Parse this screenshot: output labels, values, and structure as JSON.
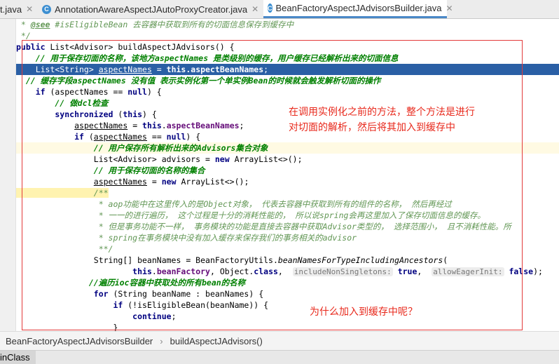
{
  "tabs": [
    {
      "label": "t.java",
      "active": false
    },
    {
      "label": "AnnotationAwareAspectJAutoProxyCreator.java",
      "active": false
    },
    {
      "label": "BeanFactoryAspectJAdvisorsBuilder.java",
      "active": true
    }
  ],
  "code": {
    "l0_a": " * ",
    "l0_see": "@see",
    "l0_b": " #isEligibleBean 去容器中获取到所有的切面信息保存到缓存中",
    "l1": " */",
    "l2_kw": "public",
    "l2_rest": " List<Advisor> buildAspectJAdvisors() {",
    "l3": "    // 用于保存切面的名称，该地方aspectNames 是类级别的缓存，用户缓存已经解析出来的切面信息",
    "l4_a": "    List<String> ",
    "l4_b": "aspectNames",
    "l4_c": " = ",
    "l4_d": "this.aspectBeanNames",
    "l4_e": ";",
    "l5": "  // 缓存字段aspectNames 没有值 表示实例化第一个单实例Bean的时候就会触发解析切面的操作",
    "l6_kw": "    if",
    "l6_rest": " (aspectNames == ",
    "l6_null": "null",
    "l6_end": ") {",
    "l7": "        // 做dcl检查",
    "l8_kw": "        synchronized",
    "l8_a": " (",
    "l8_this": "this",
    "l8_b": ") {",
    "l9_a": "            ",
    "l9_b": "aspectNames",
    "l9_c": " = ",
    "l9_this": "this",
    "l9_d": ".",
    "l9_f": "aspectBeanNames",
    "l9_e": ";",
    "l10_kw": "            if",
    "l10_rest": " (",
    "l10_an": "aspectNames",
    "l10_mid": " == ",
    "l10_null": "null",
    "l10_end": ") {",
    "l11": "                // 用户保存所有解析出来的Advisors集合对象",
    "l12_a": "                List<Advisor> advisors = ",
    "l12_new": "new",
    "l12_b": " ArrayList<>();",
    "l13": "                // 用于保存切面的名称的集合",
    "l14_a": "                ",
    "l14_b": "aspectNames",
    "l14_c": " = ",
    "l14_new": "new",
    "l14_d": " ArrayList<>();",
    "l15": "                /**",
    "l16": "                 * aop功能中在这里传入的是Object对象， 代表去容器中获取到所有的组件的名称， 然后再经过",
    "l17": "                 * 一一的进行遍历， 这个过程是十分的消耗性能的， 所以说spring会再这里加入了保存切面信息的缓存。",
    "l18": "                 * 但是事务功能不一样， 事务模块的功能是直接去容器中获取Advisor类型的， 选择范围小， 且不消耗性能。所",
    "l19": "                 * spring在事务模块中没有加入缓存来保存我们的事务相关的advisor",
    "l20": "                 **/",
    "l21_a": "                String[] beanNames = BeanFactoryUtils.",
    "l21_b": "beanNamesForTypeIncludingAncestors",
    "l21_c": "(",
    "l22_a": "                        ",
    "l22_this": "this",
    "l22_b": ".",
    "l22_bf": "beanFactory",
    "l22_c": ", Object.",
    "l22_class": "class",
    "l22_d": ",  ",
    "l22_h1": "includeNonSingletons:",
    "l22_t": " true",
    "l22_e": ",  ",
    "l22_h2": "allowEagerInit:",
    "l22_f": " false",
    "l22_g": ");",
    "l23": "               //遍历ioc容器中获取处的所有bean的名称",
    "l24_kw": "                for",
    "l24_rest": " (String beanName : beanNames) {",
    "l25_kw": "                    if",
    "l25_rest": " (!isEligibleBean(beanName)) {",
    "l26_kw": "                        continue",
    "l26_rest": ";",
    "l27": "                    }"
  },
  "annotations": {
    "note1_line1": "在调用实例化之前的方法，整个方法是进行",
    "note1_line2": "对切面的解析，然后将其加入到缓存中",
    "note2": "为什么加入到缓存中呢？",
    "box_color": "#e33a3a"
  },
  "breadcrumb": {
    "class": "BeanFactoryAspectJAdvisorsBuilder",
    "separator": "›",
    "method": "buildAspectJAdvisors()"
  },
  "bottom": {
    "label": "inClass"
  }
}
